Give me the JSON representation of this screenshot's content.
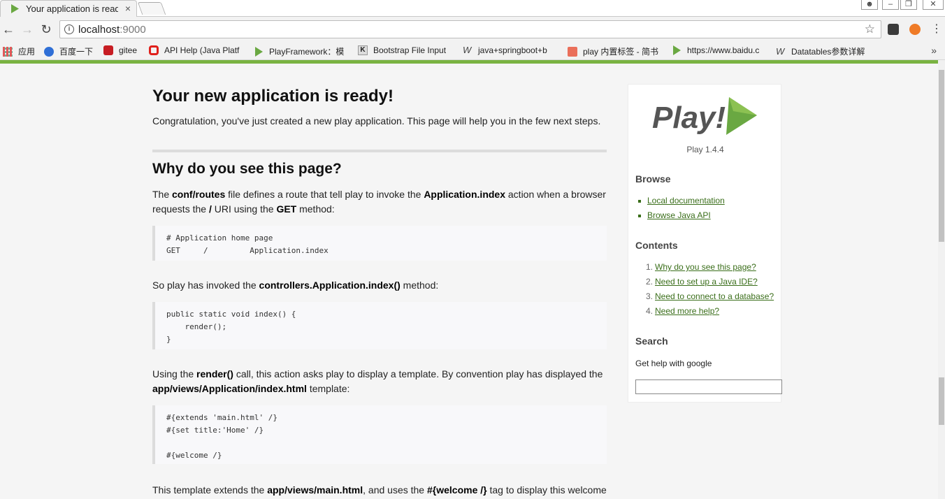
{
  "browser": {
    "tab_title": "Your application is read",
    "tab_close": "×",
    "url_host": "localhost",
    "url_port": ":9000",
    "bookmarks": [
      {
        "label": "应用",
        "icon": "apps-grid-icon"
      },
      {
        "label": "百度一下",
        "icon": "baidu-paw-icon"
      },
      {
        "label": "gitee",
        "icon": "gitee-icon"
      },
      {
        "label": "API Help (Java Platf",
        "icon": "oracle-icon"
      },
      {
        "label": "PlayFramework：模",
        "icon": "play-icon"
      },
      {
        "label": "Bootstrap File Input",
        "icon": "k-icon"
      },
      {
        "label": "java+springboot+b",
        "icon": "wiki-icon"
      },
      {
        "label": "play 内置标签 - 简书",
        "icon": "jianshu-icon"
      },
      {
        "label": "https://www.baidu.c",
        "icon": "play-icon"
      },
      {
        "label": "Datatables参数详解",
        "icon": "wiki-icon"
      }
    ],
    "more": "»",
    "colors": {
      "accent_green": "#7ab342",
      "link_green": "#3a6e1a"
    }
  },
  "main": {
    "title": "Your new application is ready!",
    "intro": "Congratulation, you've just created a new play application. This page will help you in the few next steps.",
    "section_title": "Why do you see this page?",
    "p1": {
      "t1": "The ",
      "b1": "conf/routes",
      "t2": " file defines a route that tell play to invoke the ",
      "b2": "Application.index",
      "t3": " action when a browser requests the ",
      "b3": "/",
      "t4": " URI using the ",
      "b4": "GET",
      "t5": " method:"
    },
    "code1": "# Application home page\nGET     /         Application.index",
    "p2": {
      "t1": "So play has invoked the ",
      "b1": "controllers.Application.index()",
      "t2": " method:"
    },
    "code2": "public static void index() {\n    render();\n}",
    "p3": {
      "t1": "Using the ",
      "b1": "render()",
      "t2": " call, this action asks play to display a template. By convention play has displayed the ",
      "b2": "app/views/Application/index.html",
      "t3": " template:"
    },
    "code3": "#{extends 'main.html' /}\n#{set title:'Home' /}\n\n#{welcome /}",
    "p4": {
      "t1": "This template extends the ",
      "b1": "app/views/main.html",
      "t2": ", and uses the ",
      "b2": "#{welcome /}",
      "t3": " tag to display this welcome"
    }
  },
  "sidebar": {
    "logo_text": "Play!",
    "version": "Play 1.4.4",
    "browse_title": "Browse",
    "browse_links": [
      "Local documentation",
      "Browse Java API"
    ],
    "contents_title": "Contents",
    "contents_links": [
      "Why do you see this page?",
      "Need to set up a Java IDE?",
      "Need to connect to a database?",
      "Need more help?"
    ],
    "search_title": "Search",
    "search_text": "Get help with google",
    "search_value": ""
  }
}
